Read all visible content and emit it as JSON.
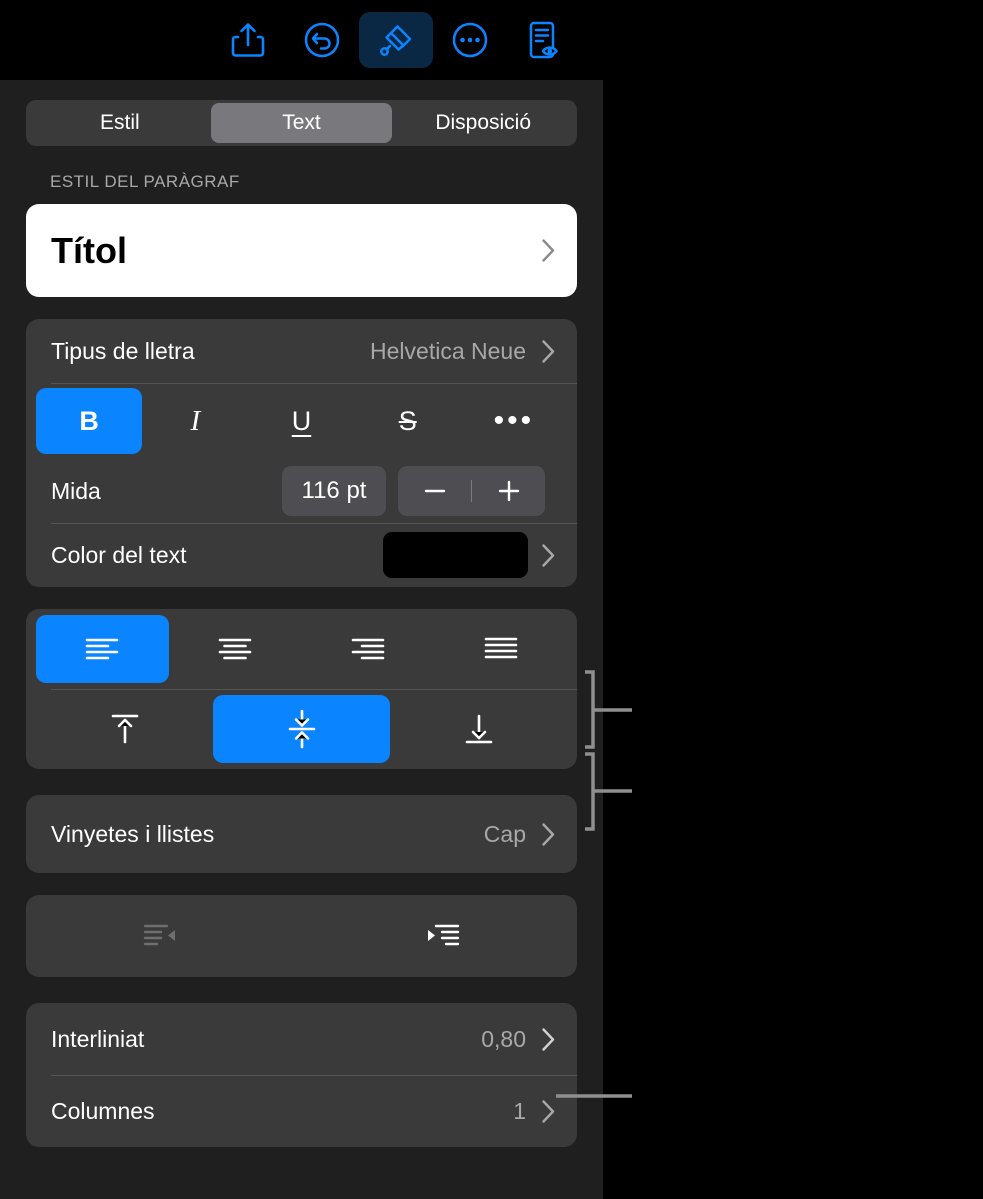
{
  "toolbar": {
    "buttons": [
      {
        "name": "share-icon",
        "label": "Comparteix"
      },
      {
        "name": "undo-icon",
        "label": "Desfés"
      },
      {
        "name": "format-brush-icon",
        "label": "Format"
      },
      {
        "name": "more-options-icon",
        "label": "Més"
      },
      {
        "name": "document-preview-icon",
        "label": "Document"
      }
    ]
  },
  "segmented": {
    "options": [
      "Estil",
      "Text",
      "Disposició"
    ],
    "selected": "Text"
  },
  "paragraph_style": {
    "section_label": "ESTIL DEL PARÀGRAF",
    "value": "Títol"
  },
  "font": {
    "label": "Tipus de lletra",
    "value": "Helvetica Neue",
    "style_buttons": [
      {
        "name": "bold-button",
        "glyph": "B",
        "active": true
      },
      {
        "name": "italic-button",
        "glyph": "I",
        "active": false
      },
      {
        "name": "underline-button",
        "glyph": "U",
        "active": false
      },
      {
        "name": "strikethrough-button",
        "glyph": "S",
        "active": false
      },
      {
        "name": "more-text-options-button",
        "glyph": "•••",
        "active": false
      }
    ]
  },
  "size": {
    "label": "Mida",
    "value": "116 pt",
    "decrease": "−",
    "increase": "+"
  },
  "text_color": {
    "label": "Color del text",
    "swatch_color": "#000000"
  },
  "alignment": {
    "horizontal": [
      {
        "name": "align-left-button",
        "active": true
      },
      {
        "name": "align-center-button",
        "active": false
      },
      {
        "name": "align-right-button",
        "active": false
      },
      {
        "name": "align-justify-button",
        "active": false
      }
    ],
    "vertical": [
      {
        "name": "align-top-button",
        "active": false
      },
      {
        "name": "align-middle-button",
        "active": true
      },
      {
        "name": "align-bottom-button",
        "active": false
      }
    ]
  },
  "bullets": {
    "label": "Vinyetes i llistes",
    "value": "Cap"
  },
  "indent": {
    "outdent": {
      "name": "decrease-indent-button",
      "enabled": false
    },
    "indent": {
      "name": "increase-indent-button",
      "enabled": true
    }
  },
  "line_spacing": {
    "label": "Interliniat",
    "value": "0,80"
  },
  "columns": {
    "label": "Columnes",
    "value": "1"
  },
  "colors": {
    "accent": "#0a84ff",
    "panel_bg": "#1f1f1f",
    "card_bg": "#3a3a3a",
    "toolbar_bg": "#000000",
    "selected_segment": "#79797d"
  }
}
